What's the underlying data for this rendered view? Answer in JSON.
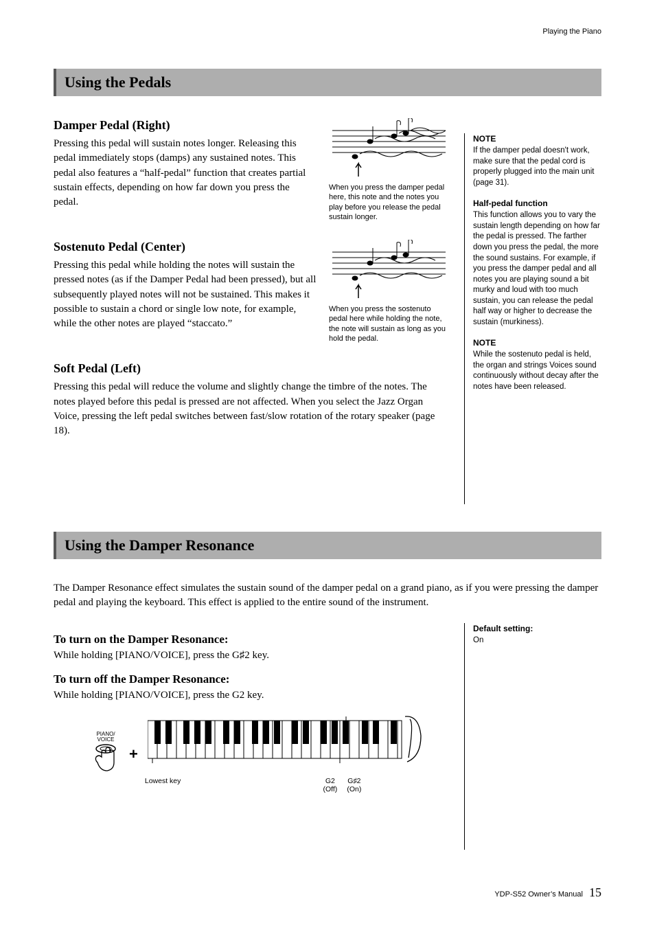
{
  "running_header": "Playing the Piano",
  "section1": {
    "title": "Using the Pedals",
    "damper": {
      "title": "Damper Pedal (Right)",
      "body": "Pressing this pedal will sustain notes longer. Releasing this pedal immediately stops (damps) any sustained notes. This pedal also features a “half-pedal” function that creates partial sustain effects, depending on how far down you press the pedal.",
      "caption": "When you press the damper pedal here, this note and the notes you play before you release the pedal sustain longer."
    },
    "sostenuto": {
      "title": "Sostenuto Pedal (Center)",
      "body": "Pressing this pedal while holding the notes will sustain the pressed notes (as if the Damper Pedal had been pressed), but all subsequently played notes will not be sustained. This makes it possible to sustain a chord or single low note, for example, while the other notes are played “staccato.”",
      "caption": "When you press the sostenuto pedal here while holding the note, the note will sustain as long as you hold the pedal."
    },
    "soft": {
      "title": "Soft Pedal (Left)",
      "body": "Pressing this pedal will reduce the volume and slightly change the timbre of the notes. The notes played before this pedal is pressed are not affected. When you select the Jazz Organ Voice, pressing the left pedal switches between fast/slow rotation of the rotary speaker (page 18)."
    },
    "side": {
      "note1_title": "NOTE",
      "note1_body": "If the damper pedal doesn't work, make sure that the pedal cord is properly plugged into the main unit (page 31).",
      "half_title": "Half-pedal function",
      "half_body": "This function allows you to vary the sustain length depending on how far the pedal is pressed. The farther down you press the pedal, the more the sound sustains. For example, if you press the damper pedal and all notes you are playing sound a bit murky and loud with too much sustain, you can release the pedal half way or higher to decrease the sustain (murkiness).",
      "note2_title": "NOTE",
      "note2_body": "While the sostenuto pedal is held, the organ and strings Voices sound continuously without decay after the notes have been released."
    }
  },
  "section2": {
    "title": "Using the Damper Resonance",
    "intro": "The Damper Resonance effect simulates the sustain sound of the damper pedal on a grand piano, as if you were pressing the damper pedal and playing the keyboard. This effect is applied to the entire sound of the instrument.",
    "on_title": "To turn on the Damper Resonance:",
    "on_body": "While holding [PIANO/VOICE], press the G♯2 key.",
    "off_title": "To turn off the Damper Resonance:",
    "off_body": "While holding [PIANO/VOICE], press the G2 key.",
    "side": {
      "default_title": "Default setting:",
      "default_value": "On"
    },
    "kb": {
      "piano_voice": "PIANO/\nVOICE",
      "plus": "+",
      "lowest": "Lowest key",
      "g2": "G2",
      "g2_sub": "(Off)",
      "gs2": "G♯2",
      "gs2_sub": "(On)"
    }
  },
  "footer": {
    "manual": "YDP-S52 Owner’s Manual",
    "page": "15"
  }
}
